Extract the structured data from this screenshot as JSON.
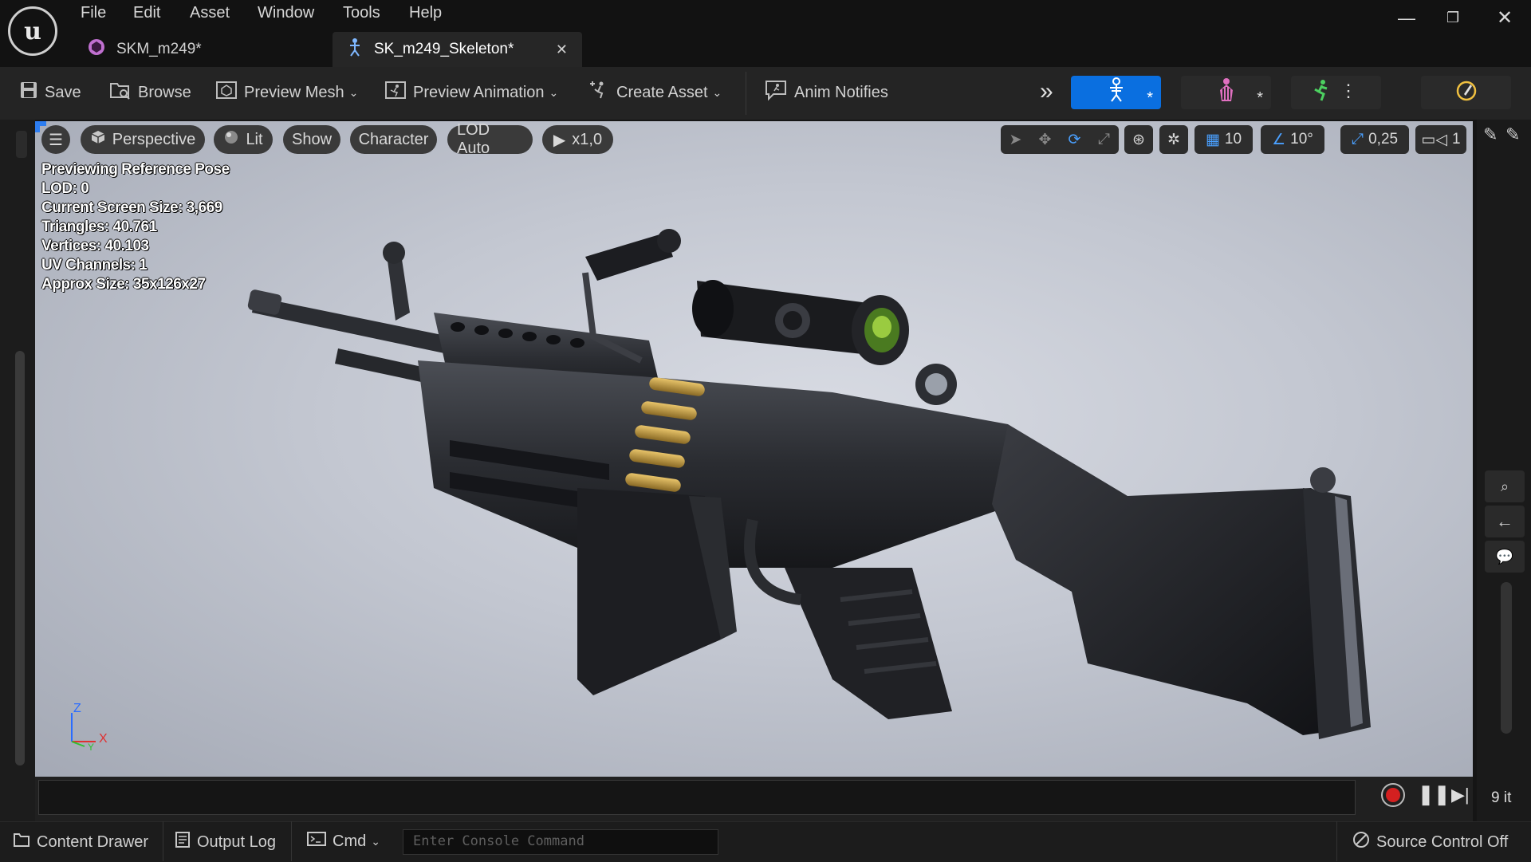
{
  "menu": [
    "File",
    "Edit",
    "Asset",
    "Window",
    "Tools",
    "Help"
  ],
  "tabs": [
    {
      "label": "SKM_m249*",
      "icon": "mesh-icon",
      "active": false
    },
    {
      "label": "SK_m249_Skeleton*",
      "icon": "skeleton-icon",
      "active": true
    }
  ],
  "toolbar": {
    "save": "Save",
    "browse": "Browse",
    "preview_mesh": "Preview Mesh",
    "preview_animation": "Preview Animation",
    "create_asset": "Create Asset",
    "anim_notifies": "Anim Notifies"
  },
  "viewport": {
    "perspective": "Perspective",
    "lit": "Lit",
    "show": "Show",
    "character": "Character",
    "lod": "LOD Auto",
    "speed": "x1,0",
    "grid_snap": "10",
    "rotation_snap": "10°",
    "scale_snap": "0,25",
    "camera_speed": "1",
    "stats": [
      "Previewing Reference Pose",
      "LOD: 0",
      "Current Screen Size: 3,669",
      "Triangles: 40.761",
      "Vertices: 40.103",
      "UV Channels: 1",
      "Approx Size: 35x126x27"
    ],
    "axis": {
      "z": "Z",
      "x": "X",
      "y": "Y"
    }
  },
  "playback": {
    "frame_label": "9 it"
  },
  "statusbar": {
    "content_drawer": "Content Drawer",
    "output_log": "Output Log",
    "cmd": "Cmd",
    "console_placeholder": "Enter Console Command",
    "source_control": "Source Control Off"
  },
  "colors": {
    "accent": "#0070e0",
    "record": "#d42020",
    "mode_active": "#0a6fe0"
  }
}
